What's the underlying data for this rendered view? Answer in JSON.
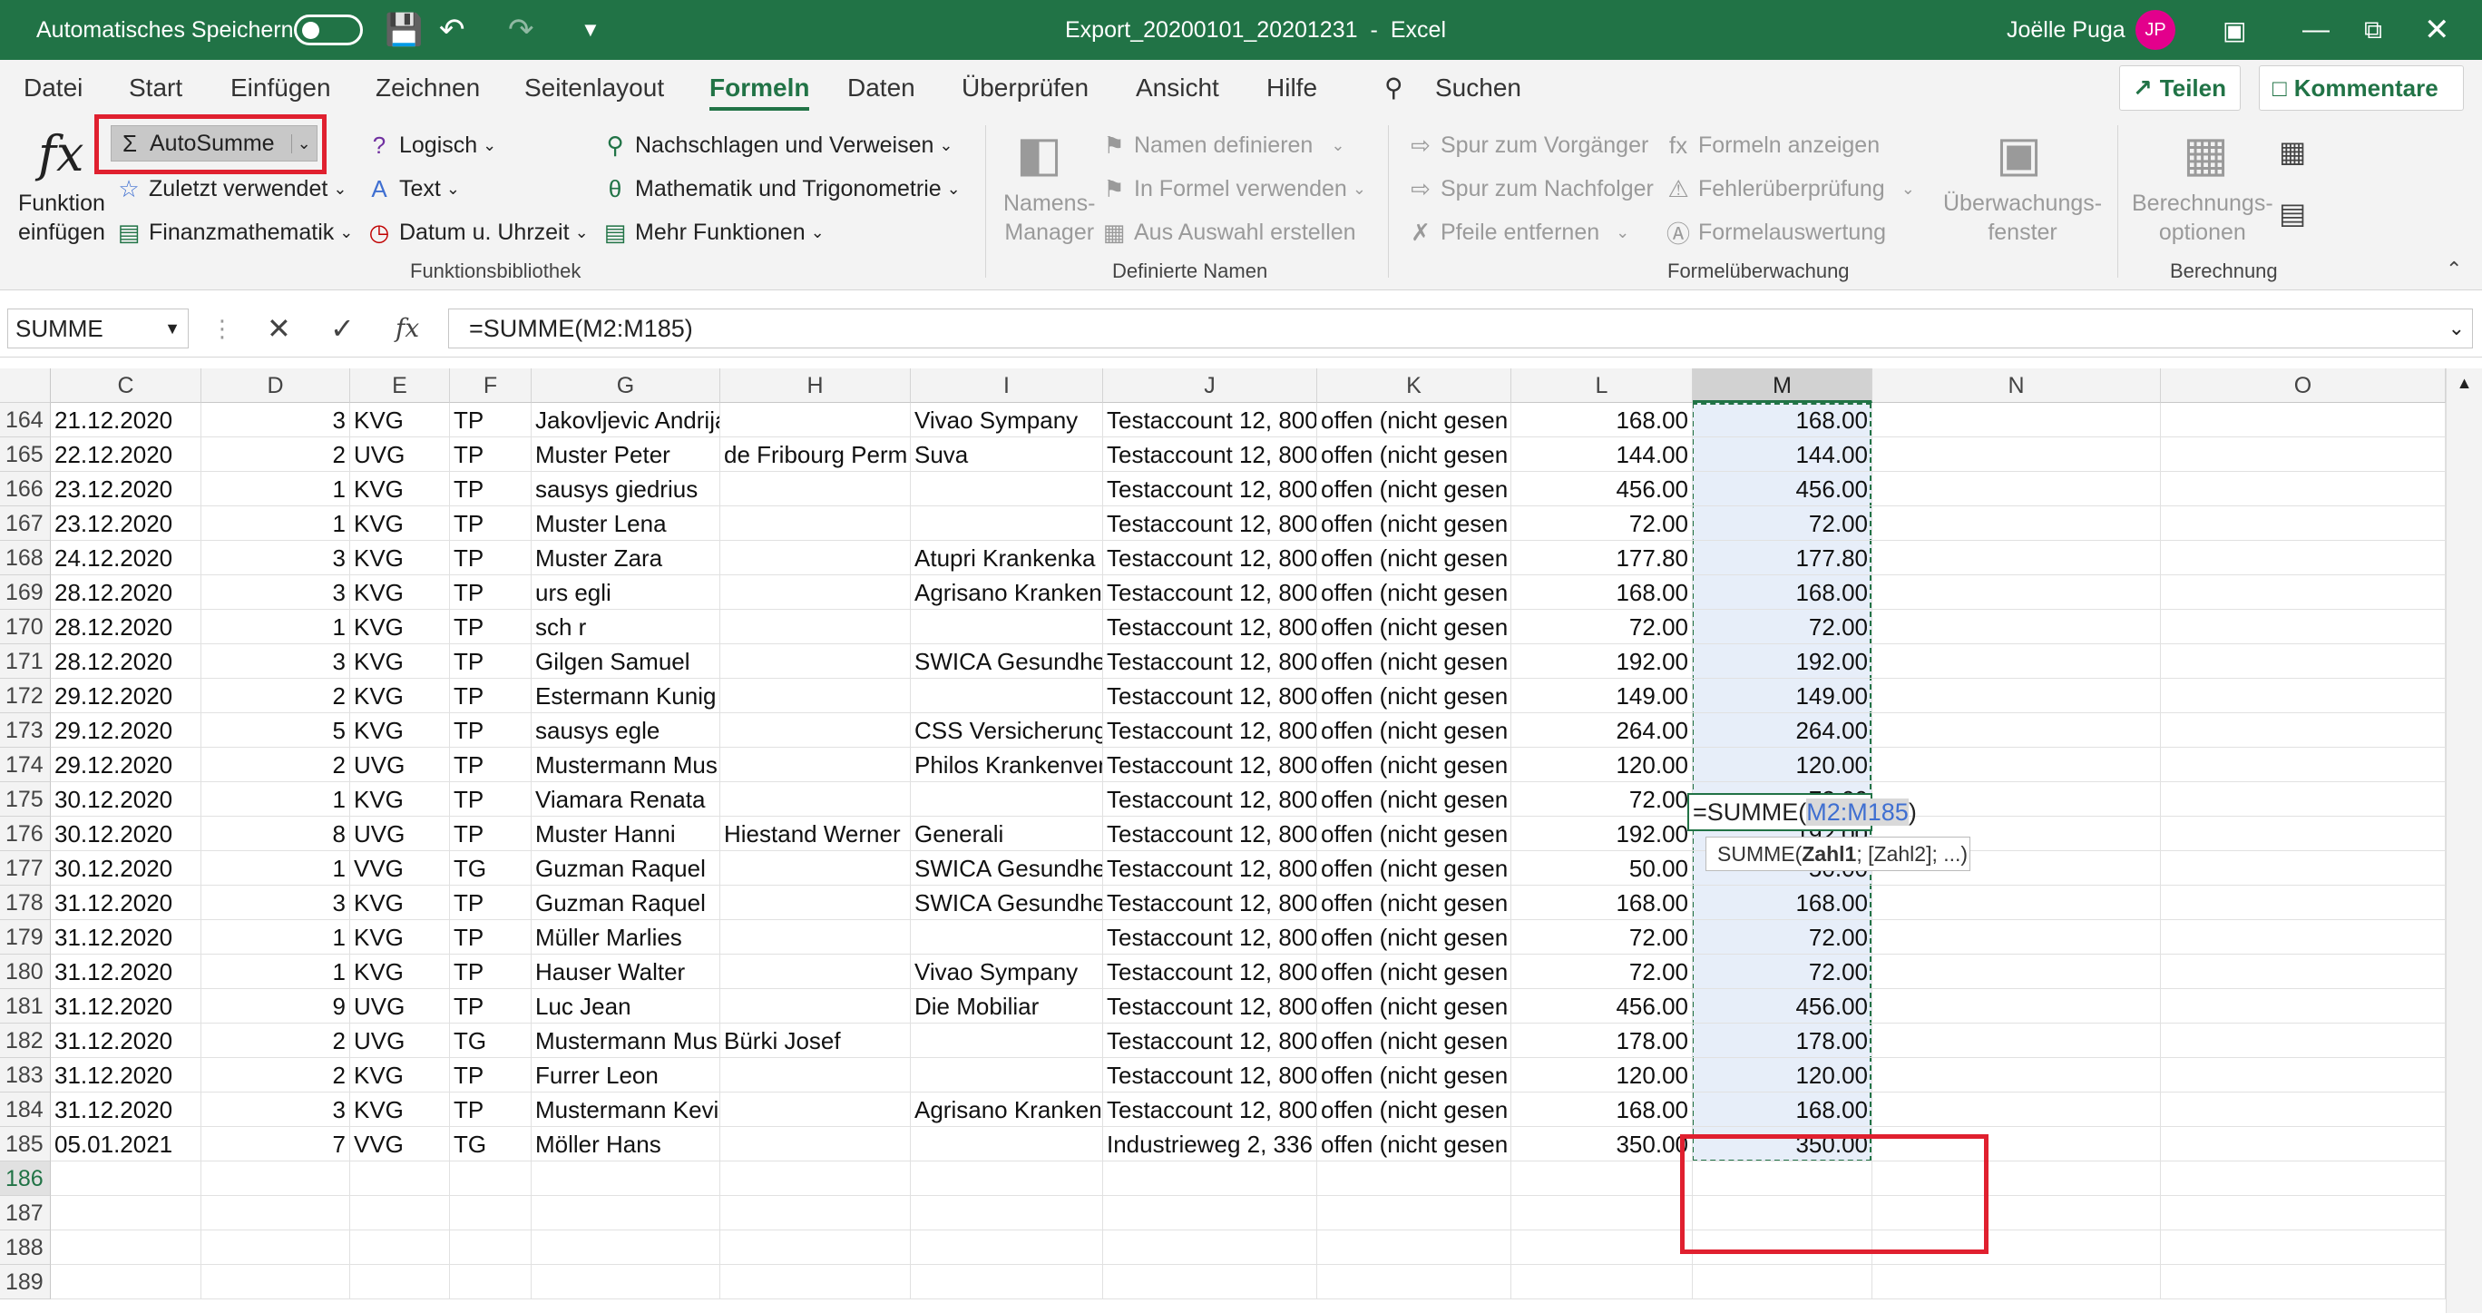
{
  "titlebar": {
    "autosave_label": "Automatisches Speichern",
    "filename": "Export_20200101_20201231",
    "app": "Excel",
    "user": "Joëlle Puga",
    "initials": "JP"
  },
  "menu": {
    "tabs": [
      "Datei",
      "Start",
      "Einfügen",
      "Zeichnen",
      "Seitenlayout",
      "Formeln",
      "Daten",
      "Überprüfen",
      "Ansicht",
      "Hilfe"
    ],
    "search": "Suchen",
    "share": "Teilen",
    "comments": "Kommentare"
  },
  "ribbon": {
    "insert_function": [
      "Funktion",
      "einfügen"
    ],
    "autosum": "AutoSumme",
    "recent": "Zuletzt verwendet",
    "financial": "Finanzmathematik",
    "logical": "Logisch",
    "text": "Text",
    "datetime": "Datum u. Uhrzeit",
    "lookup": "Nachschlagen und Verweisen",
    "math": "Mathematik und Trigonometrie",
    "more": "Mehr Funktionen",
    "group1": "Funktionsbibliothek",
    "name_manager": [
      "Namens-",
      "Manager"
    ],
    "define_name": "Namen definieren",
    "use_in_formula": "In Formel verwenden",
    "create_from_selection": "Aus Auswahl erstellen",
    "group2": "Definierte Namen",
    "trace_precedents": "Spur zum Vorgänger",
    "trace_dependents": "Spur zum Nachfolger",
    "remove_arrows": "Pfeile entfernen",
    "show_formulas": "Formeln anzeigen",
    "error_checking": "Fehlerüberprüfung",
    "evaluate": "Formelauswertung",
    "watch_window": [
      "Überwachungs-",
      "fenster"
    ],
    "group3": "Formelüberwachung",
    "calc_options": [
      "Berechnungs-",
      "optionen"
    ],
    "group4": "Berechnung"
  },
  "formula_bar": {
    "namebox": "SUMME",
    "formula": "=SUMME(M2:M185)"
  },
  "columns": [
    "C",
    "D",
    "E",
    "F",
    "G",
    "H",
    "I",
    "J",
    "K",
    "L",
    "M",
    "N",
    "O"
  ],
  "rows": [
    {
      "n": "164",
      "c": "21.12.2020",
      "d": "3",
      "e": "KVG",
      "f": "TP",
      "g": "Jakovljevic Andrija",
      "h": "",
      "i": "Vivao Sympany",
      "j": "Testaccount 12, 800",
      "k": "offen (nicht gesen",
      "l": "168.00",
      "m": "168.00"
    },
    {
      "n": "165",
      "c": "22.12.2020",
      "d": "2",
      "e": "UVG",
      "f": "TP",
      "g": "Muster Peter",
      "h": "de Fribourg Perm",
      "i": "Suva",
      "j": "Testaccount 12, 800",
      "k": "offen (nicht gesen",
      "l": "144.00",
      "m": "144.00"
    },
    {
      "n": "166",
      "c": "23.12.2020",
      "d": "1",
      "e": "KVG",
      "f": "TP",
      "g": "sausys giedrius",
      "h": "",
      "i": "",
      "j": "Testaccount 12, 800",
      "k": "offen (nicht gesen",
      "l": "456.00",
      "m": "456.00"
    },
    {
      "n": "167",
      "c": "23.12.2020",
      "d": "1",
      "e": "KVG",
      "f": "TP",
      "g": "Muster Lena",
      "h": "",
      "i": "",
      "j": "Testaccount 12, 800",
      "k": "offen (nicht gesen",
      "l": "72.00",
      "m": "72.00"
    },
    {
      "n": "168",
      "c": "24.12.2020",
      "d": "3",
      "e": "KVG",
      "f": "TP",
      "g": "Muster Zara",
      "h": "",
      "i": "Atupri Krankenka",
      "j": "Testaccount 12, 800",
      "k": "offen (nicht gesen",
      "l": "177.80",
      "m": "177.80"
    },
    {
      "n": "169",
      "c": "28.12.2020",
      "d": "3",
      "e": "KVG",
      "f": "TP",
      "g": "urs egli",
      "h": "",
      "i": "Agrisano Kranken",
      "j": "Testaccount 12, 800",
      "k": "offen (nicht gesen",
      "l": "168.00",
      "m": "168.00"
    },
    {
      "n": "170",
      "c": "28.12.2020",
      "d": "1",
      "e": "KVG",
      "f": "TP",
      "g": "sch r",
      "h": "",
      "i": "",
      "j": "Testaccount 12, 800",
      "k": "offen (nicht gesen",
      "l": "72.00",
      "m": "72.00"
    },
    {
      "n": "171",
      "c": "28.12.2020",
      "d": "3",
      "e": "KVG",
      "f": "TP",
      "g": "Gilgen Samuel",
      "h": "",
      "i": "SWICA Gesundhei",
      "j": "Testaccount 12, 800",
      "k": "offen (nicht gesen",
      "l": "192.00",
      "m": "192.00"
    },
    {
      "n": "172",
      "c": "29.12.2020",
      "d": "2",
      "e": "KVG",
      "f": "TP",
      "g": "Estermann Kunig",
      "h": "",
      "i": "",
      "j": "Testaccount 12, 800",
      "k": "offen (nicht gesen",
      "l": "149.00",
      "m": "149.00"
    },
    {
      "n": "173",
      "c": "29.12.2020",
      "d": "5",
      "e": "KVG",
      "f": "TP",
      "g": "sausys egle",
      "h": "",
      "i": "CSS Versicherung",
      "j": "Testaccount 12, 800",
      "k": "offen (nicht gesen",
      "l": "264.00",
      "m": "264.00"
    },
    {
      "n": "174",
      "c": "29.12.2020",
      "d": "2",
      "e": "UVG",
      "f": "TP",
      "g": "Mustermann Mus",
      "h": "",
      "i": "Philos Krankenver",
      "j": "Testaccount 12, 800",
      "k": "offen (nicht gesen",
      "l": "120.00",
      "m": "120.00"
    },
    {
      "n": "175",
      "c": "30.12.2020",
      "d": "1",
      "e": "KVG",
      "f": "TP",
      "g": "Viamara Renata",
      "h": "",
      "i": "",
      "j": "Testaccount 12, 800",
      "k": "offen (nicht gesen",
      "l": "72.00",
      "m": "72.00"
    },
    {
      "n": "176",
      "c": "30.12.2020",
      "d": "8",
      "e": "UVG",
      "f": "TP",
      "g": "Muster Hanni",
      "h": "Hiestand Werner",
      "i": "Generali",
      "j": "Testaccount 12, 800",
      "k": "offen (nicht gesen",
      "l": "192.00",
      "m": "192.00"
    },
    {
      "n": "177",
      "c": "30.12.2020",
      "d": "1",
      "e": "VVG",
      "f": "TG",
      "g": "Guzman Raquel",
      "h": "",
      "i": "SWICA Gesundhei",
      "j": "Testaccount 12, 800",
      "k": "offen (nicht gesen",
      "l": "50.00",
      "m": "50.00"
    },
    {
      "n": "178",
      "c": "31.12.2020",
      "d": "3",
      "e": "KVG",
      "f": "TP",
      "g": "Guzman Raquel",
      "h": "",
      "i": "SWICA Gesundhei",
      "j": "Testaccount 12, 800",
      "k": "offen (nicht gesen",
      "l": "168.00",
      "m": "168.00"
    },
    {
      "n": "179",
      "c": "31.12.2020",
      "d": "1",
      "e": "KVG",
      "f": "TP",
      "g": "Müller Marlies",
      "h": "",
      "i": "",
      "j": "Testaccount 12, 800",
      "k": "offen (nicht gesen",
      "l": "72.00",
      "m": "72.00"
    },
    {
      "n": "180",
      "c": "31.12.2020",
      "d": "1",
      "e": "KVG",
      "f": "TP",
      "g": "Hauser Walter",
      "h": "",
      "i": "Vivao Sympany",
      "j": "Testaccount 12, 800",
      "k": "offen (nicht gesen",
      "l": "72.00",
      "m": "72.00"
    },
    {
      "n": "181",
      "c": "31.12.2020",
      "d": "9",
      "e": "UVG",
      "f": "TP",
      "g": "Luc Jean",
      "h": "",
      "i": "Die Mobiliar",
      "j": "Testaccount 12, 800",
      "k": "offen (nicht gesen",
      "l": "456.00",
      "m": "456.00"
    },
    {
      "n": "182",
      "c": "31.12.2020",
      "d": "2",
      "e": "UVG",
      "f": "TG",
      "g": "Mustermann Mus",
      "h": "Bürki Josef",
      "i": "",
      "j": "Testaccount 12, 800",
      "k": "offen (nicht gesen",
      "l": "178.00",
      "m": "178.00"
    },
    {
      "n": "183",
      "c": "31.12.2020",
      "d": "2",
      "e": "KVG",
      "f": "TP",
      "g": "Furrer Leon",
      "h": "",
      "i": "",
      "j": "Testaccount 12, 800",
      "k": "offen (nicht gesen",
      "l": "120.00",
      "m": "120.00"
    },
    {
      "n": "184",
      "c": "31.12.2020",
      "d": "3",
      "e": "KVG",
      "f": "TP",
      "g": "Mustermann Kevi",
      "h": "",
      "i": "Agrisano Kranken",
      "j": "Testaccount 12, 800",
      "k": "offen (nicht gesen",
      "l": "168.00",
      "m": "168.00"
    },
    {
      "n": "185",
      "c": "05.01.2021",
      "d": "7",
      "e": "VVG",
      "f": "TG",
      "g": "Möller Hans",
      "h": "",
      "i": "",
      "j": "Industrieweg 2, 336",
      "k": "offen (nicht gesen",
      "l": "350.00",
      "m": "350.00"
    },
    {
      "n": "186",
      "c": "",
      "d": "",
      "e": "",
      "f": "",
      "g": "",
      "h": "",
      "i": "",
      "j": "",
      "k": "",
      "l": "",
      "m": ""
    },
    {
      "n": "187",
      "c": "",
      "d": "",
      "e": "",
      "f": "",
      "g": "",
      "h": "",
      "i": "",
      "j": "",
      "k": "",
      "l": "",
      "m": ""
    },
    {
      "n": "188",
      "c": "",
      "d": "",
      "e": "",
      "f": "",
      "g": "",
      "h": "",
      "i": "",
      "j": "",
      "k": "",
      "l": "",
      "m": ""
    },
    {
      "n": "189",
      "c": "",
      "d": "",
      "e": "",
      "f": "",
      "g": "",
      "h": "",
      "i": "",
      "j": "",
      "k": "",
      "l": "",
      "m": ""
    }
  ],
  "edit": {
    "prefix": "=SUMME(",
    "range": "M2:M185",
    "suffix": ")",
    "tooltip_fn": "SUMME(",
    "tooltip_arg1": "Zahl1",
    "tooltip_rest": "; [Zahl2]; ...)"
  }
}
